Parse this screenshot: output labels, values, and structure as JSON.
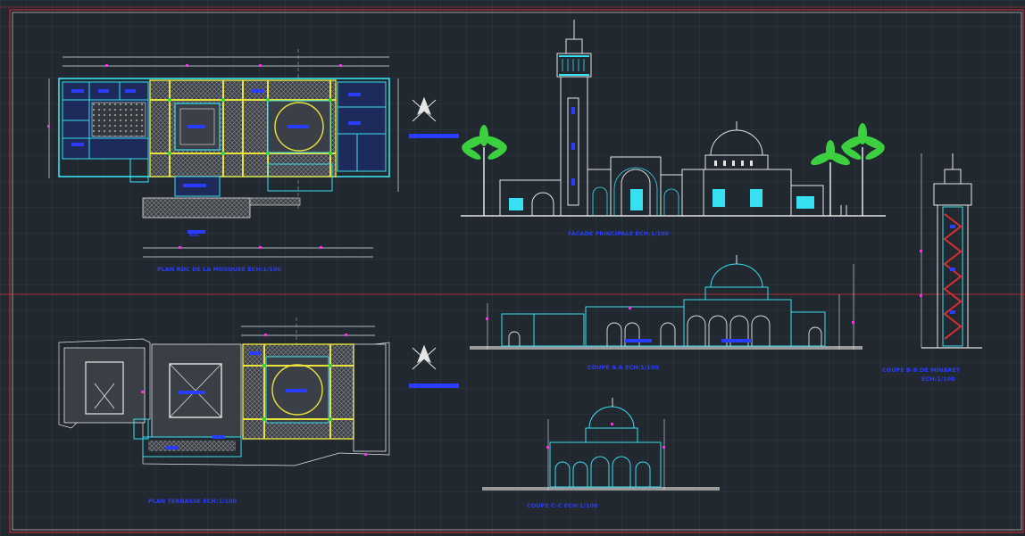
{
  "drawing": {
    "background": "#212830",
    "grid_color": "#2f3a45",
    "colors": {
      "cyan": "#37e0f0",
      "yellow": "#e8e23a",
      "white": "#e6e6e6",
      "blue": "#2a3cff",
      "magenta": "#e040d0",
      "red": "#d83030",
      "green": "#3cd040",
      "grey": "#9a9a9a"
    },
    "labels": {
      "plan_ground": "PLAN RDC DE LA MOSQUEE ECH:1/100",
      "elevation_main": "FACADE PRINCIPALE ECH:1/100",
      "section_aa": "COUPE A-A ECH:1/100",
      "section_minaret": "COUPE B-B DE MINARET",
      "section_minaret_scale": "ECH:1/100",
      "plan_upper": "PLAN TERRASSE ECH:1/100",
      "section_cc": "COUPE C-C ECH:1/100",
      "north_tag_1": "ECH:1/100",
      "north_tag_2": "ECH:1/100",
      "plan_small_tag": "RDC"
    }
  }
}
